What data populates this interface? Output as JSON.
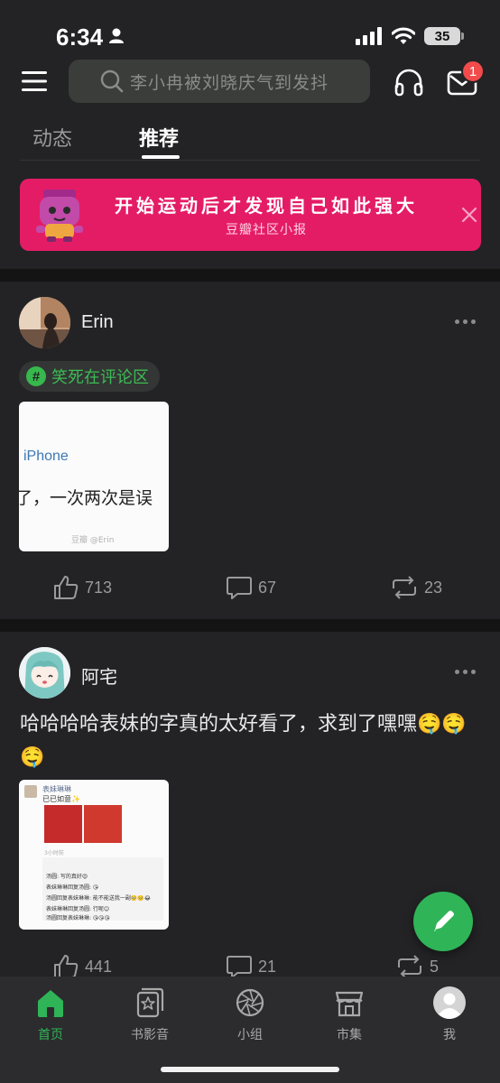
{
  "status_bar": {
    "time": "6:34",
    "battery": "35"
  },
  "search": {
    "placeholder": "李小冉被刘晓庆气到发抖"
  },
  "notifications": {
    "mail_badge": "1"
  },
  "tabs": [
    {
      "label": "动态",
      "active": false
    },
    {
      "label": "推荐",
      "active": true
    }
  ],
  "banner": {
    "title": "开始运动后才发现自己如此强大",
    "subtitle": "豆瓣社区小报",
    "background": "#e41c66"
  },
  "posts": [
    {
      "author": "Erin",
      "topic": "笑死在评论区",
      "image_text_line1": "iPhone",
      "image_text_line2": "了，一次两次是误",
      "image_watermark": "豆瓣 @Erin",
      "likes": "713",
      "comments": "67",
      "reshares": "23"
    },
    {
      "author": "阿宅",
      "text": "哈哈哈哈表妹的字真的太好看了，求到了嘿嘿🤤🤤🤤",
      "image_header_name": "表妹琳琳",
      "image_header_sub": "已已如意✨",
      "image_time": "3小时前",
      "image_comments": [
        "汤圆: 写的真好😍",
        "表妹琳琳回复汤圆: 😘",
        "汤圆回复表妹琳琳: 能不能送我一副🥺🥺😂",
        "表妹琳琳回复汤圆: 行呢😊",
        "汤圆回复表妹琳琳: 😘😘😘"
      ],
      "likes": "441",
      "comments": "21",
      "reshares": "5"
    }
  ],
  "bottom_nav": [
    {
      "label": "首页",
      "icon": "home-icon",
      "active": true
    },
    {
      "label": "书影音",
      "icon": "book-film-music-icon",
      "active": false
    },
    {
      "label": "小组",
      "icon": "group-icon",
      "active": false
    },
    {
      "label": "市集",
      "icon": "market-icon",
      "active": false
    },
    {
      "label": "我",
      "icon": "profile-icon",
      "active": false
    }
  ],
  "colors": {
    "accent": "#2fb457",
    "background": "#232325",
    "badge": "#f14b4b"
  }
}
